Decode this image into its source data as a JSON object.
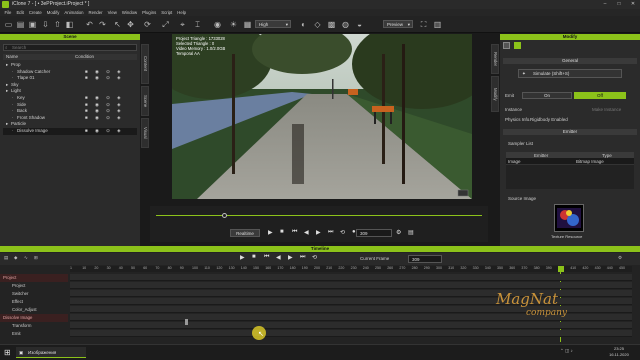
{
  "window": {
    "title": "iClone 7 - [ • 3ePProject.iProject * ]"
  },
  "menu": [
    "File",
    "Edit",
    "Create",
    "Modify",
    "Animation",
    "Render",
    "View",
    "Window",
    "Plugins",
    "Script",
    "Help"
  ],
  "toolbar": {
    "quality": "High",
    "preview": "Preview"
  },
  "scene": {
    "title": "Scene",
    "search_placeholder": "Search",
    "col_name": "Name",
    "col_condition": "Condition",
    "rows": [
      {
        "label": "Prop",
        "indent": 1,
        "group": true
      },
      {
        "label": "Shadow Catcher",
        "indent": 3,
        "group": false
      },
      {
        "label": "Tlape 01",
        "indent": 3,
        "group": false
      },
      {
        "label": "Sky",
        "indent": 1,
        "group": true
      },
      {
        "label": "Light",
        "indent": 1,
        "group": true
      },
      {
        "label": "Key",
        "indent": 3,
        "group": false
      },
      {
        "label": "Side",
        "indent": 3,
        "group": false
      },
      {
        "label": "Back",
        "indent": 3,
        "group": false
      },
      {
        "label": "Front Shadow",
        "indent": 3,
        "group": false
      },
      {
        "label": "Particle",
        "indent": 1,
        "group": true
      },
      {
        "label": "Dissolve Image",
        "indent": 3,
        "group": false,
        "selected": true
      }
    ],
    "side_tabs": [
      "Content",
      "Scene",
      "Visual"
    ]
  },
  "viewport": {
    "stats": [
      "Project Triangle : 1733028",
      "Selected Triangle : 0",
      "Video Memory : 1.0/2.0GB",
      "Temporal AA"
    ]
  },
  "playbar": {
    "realtime": "Realtime",
    "frame": "309"
  },
  "modify": {
    "title": "Modify",
    "general": "General",
    "simulate": "Simulate (Shift+S)",
    "emit_label": "Emit",
    "emit_on": "On",
    "emit_off": "Off",
    "instance_label": "Instance",
    "instance_value": "Make Instance",
    "physics_label": "Physics Info.",
    "physics_value": "Rigidbody Enabled",
    "emitter": "Emitter",
    "sampler_label": "Sampler List",
    "col_emitter": "Emitter",
    "col_type": "Type",
    "sampler_emitter": "Image",
    "sampler_type": "Bitmap Image",
    "source_label": "Source Image",
    "texture_resource": "Texture Resource",
    "side_tabs": [
      "Modify",
      "Render"
    ]
  },
  "timeline": {
    "title": "Timeline",
    "current_frame_label": "Current Frame",
    "current_frame": "309",
    "ticks": [
      "1",
      "10",
      "20",
      "30",
      "40",
      "50",
      "60",
      "70",
      "80",
      "90",
      "100",
      "110",
      "120",
      "130",
      "140",
      "150",
      "160",
      "170",
      "180",
      "190",
      "200",
      "210",
      "220",
      "230",
      "240",
      "250",
      "260",
      "270",
      "280",
      "290",
      "300",
      "310",
      "320",
      "330",
      "340",
      "350",
      "360",
      "370",
      "380",
      "390",
      "400",
      "410",
      "420",
      "430",
      "440",
      "450"
    ],
    "tracks": [
      {
        "label": "Project",
        "header": true
      },
      {
        "label": "Project",
        "header": false
      },
      {
        "label": "Switcher",
        "header": false
      },
      {
        "label": "Effect",
        "header": false
      },
      {
        "label": "Color_Adjust",
        "header": false
      },
      {
        "label": "Dissolve Image",
        "header": true
      },
      {
        "label": "Transform",
        "header": false
      },
      {
        "label": "Emit",
        "header": false
      }
    ]
  },
  "taskbar": {
    "app": "Изображения",
    "time": "23:25",
    "date": "16.11.2020"
  },
  "watermark": {
    "line1": "MagNat",
    "line2": "company"
  }
}
